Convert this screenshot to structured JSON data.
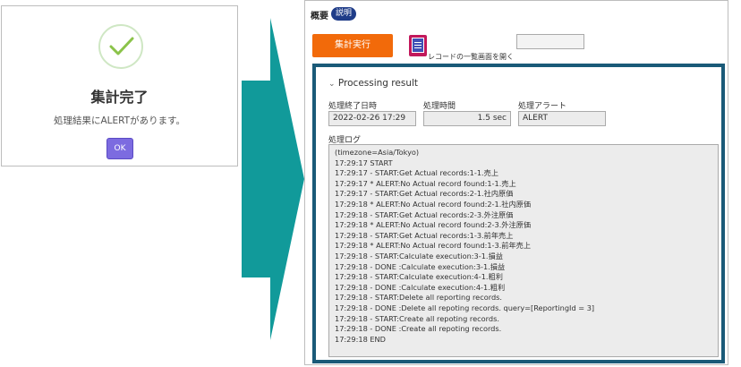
{
  "dialog": {
    "title": "集計完了",
    "message": "処理結果にALERTがあります。",
    "ok_label": "OK"
  },
  "panel": {
    "header_label": "概要",
    "badge": "説明",
    "run_button": "集計実行",
    "record_link": "レコードの一覧画面を開く",
    "result": {
      "title": "Processing result",
      "end_time_label": "処理終了日時",
      "end_time_value": "2022-02-26 17:29",
      "duration_label": "処理時間",
      "duration_value": "1.5 sec",
      "alert_label": "処理アラート",
      "alert_value": "ALERT",
      "log_label": "処理ログ",
      "log_lines": [
        "(timezone=Asia/Tokyo)",
        "17:29:17 START",
        "17:29:17 - START:Get Actual records:1-1.売上",
        "17:29:17 * ALERT:No Actual record found:1-1.売上",
        "17:29:17 - START:Get Actual records:2-1.社内原価",
        "17:29:18 * ALERT:No Actual record found:2-1.社内原価",
        "17:29:18 - START:Get Actual records:2-3.外注原価",
        "17:29:18 * ALERT:No Actual record found:2-3.外注原価",
        "17:29:18 - START:Get Actual records:1-3.前年売上",
        "17:29:18 * ALERT:No Actual record found:1-3.前年売上",
        "17:29:18 - START:Calculate execution:3-1.損益",
        "17:29:18 - DONE :Calculate execution:3-1.損益",
        "17:29:18 - START:Calculate execution:4-1.粗利",
        "17:29:18 - DONE :Calculate execution:4-1.粗利",
        "17:29:18 - START:Delete all reporting records.",
        "17:29:18 - DONE :Delete all repoting records. query=[ReportingId = 3]",
        "17:29:18 - START:Create all repoting records.",
        "17:29:18 - DONE :Create all repoting records.",
        "17:29:18 END"
      ]
    }
  },
  "colors": {
    "arrow": "#119a9a",
    "run_button": "#f26a0a",
    "result_border": "#1a5a78",
    "ok_button": "#7c6be0",
    "badge": "#1f3c88",
    "check": "#8bc34a"
  },
  "icons": [
    "check-icon",
    "record-list-icon",
    "chevron-down-icon",
    "arrow-right-icon"
  ]
}
